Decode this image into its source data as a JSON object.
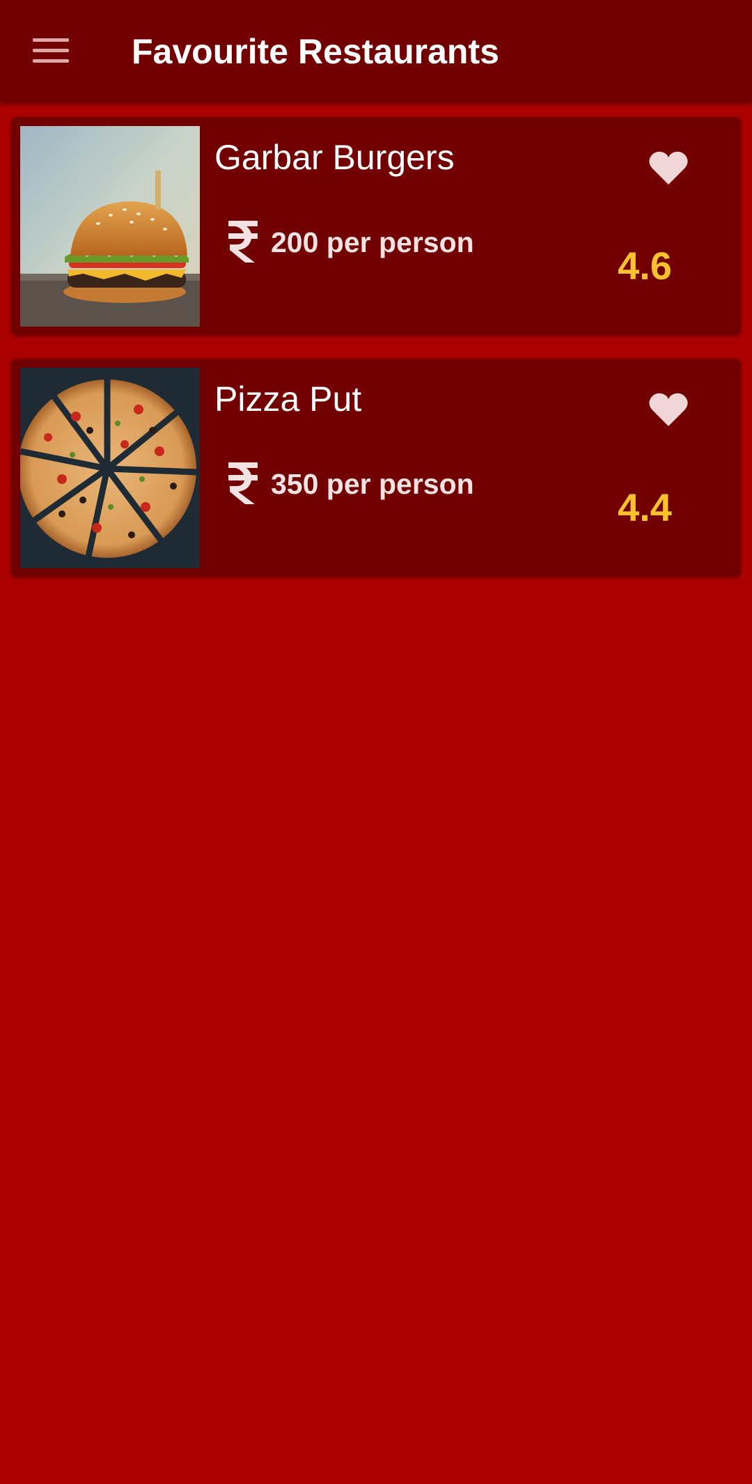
{
  "app_bar": {
    "title": "Favourite Restaurants",
    "menu_icon": "hamburger-menu-icon"
  },
  "colors": {
    "background": "#AB0000",
    "app_bar": "#720000",
    "card": "#720000",
    "rating": "#F9C22E",
    "heart": "#F0D6D6"
  },
  "restaurants": [
    {
      "name": "Garbar Burgers",
      "currency_icon": "rupee-icon",
      "price": "200 per person",
      "rating": "4.6",
      "favourite_icon": "heart-icon",
      "image_icon": "burger-image"
    },
    {
      "name": "Pizza Put",
      "currency_icon": "rupee-icon",
      "price": "350 per person",
      "rating": "4.4",
      "favourite_icon": "heart-icon",
      "image_icon": "pizza-image"
    }
  ]
}
